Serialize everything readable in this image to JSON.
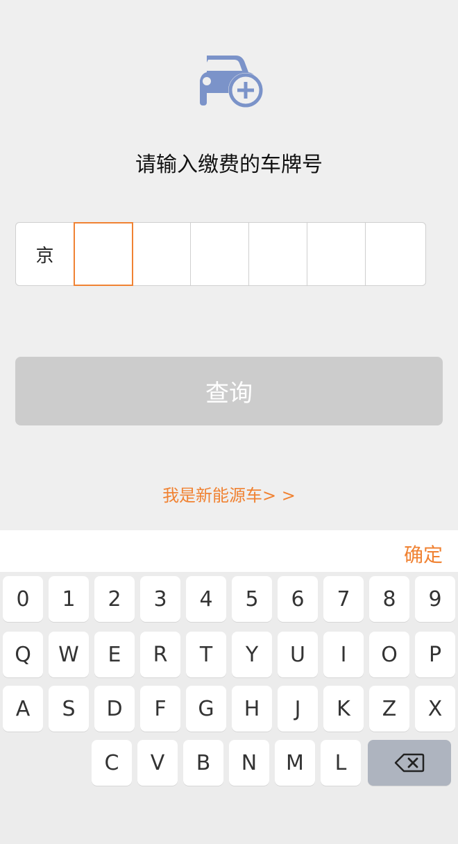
{
  "header": {
    "title": "请输入缴费的车牌号",
    "icon": "car-add-icon"
  },
  "plate": {
    "province": "京",
    "cells": [
      "",
      "",
      "",
      "",
      "",
      ""
    ],
    "active_index": 1
  },
  "actions": {
    "query_label": "查询",
    "new_energy_label": "我是新能源车> >"
  },
  "keyboard": {
    "confirm_label": "确定",
    "row1": [
      "0",
      "1",
      "2",
      "3",
      "4",
      "5",
      "6",
      "7",
      "8",
      "9"
    ],
    "row2": [
      "Q",
      "W",
      "E",
      "R",
      "T",
      "Y",
      "U",
      "I",
      "O",
      "P"
    ],
    "row3": [
      "A",
      "S",
      "D",
      "F",
      "G",
      "H",
      "J",
      "K",
      "Z",
      "X"
    ],
    "row4": [
      "C",
      "V",
      "B",
      "N",
      "M",
      "L"
    ],
    "delete_icon": "backspace-icon"
  },
  "colors": {
    "accent": "#f08232",
    "icon": "#7b93c9",
    "button_disabled": "#cccccc",
    "background": "#efefef"
  }
}
